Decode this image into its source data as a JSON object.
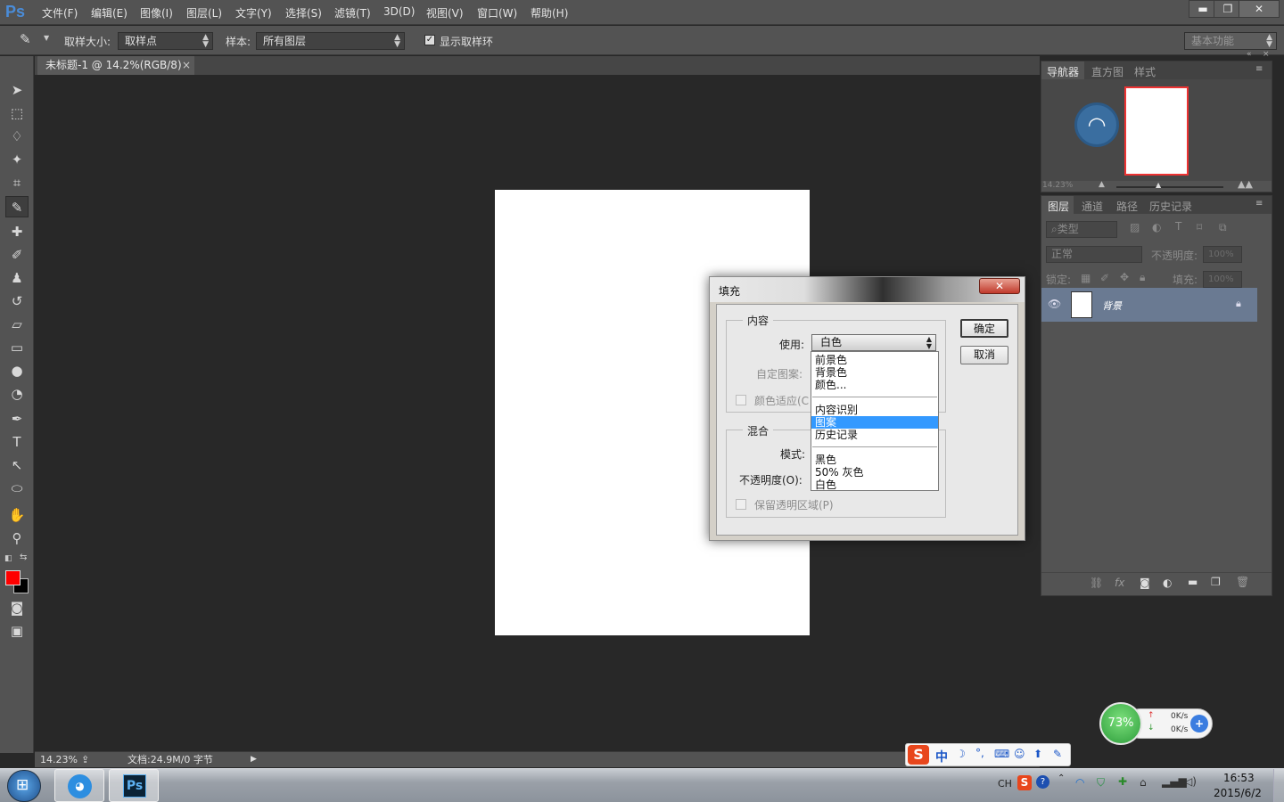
{
  "app": {
    "logo": "Ps"
  },
  "menu": [
    "文件(F)",
    "编辑(E)",
    "图像(I)",
    "图层(L)",
    "文字(Y)",
    "选择(S)",
    "滤镜(T)",
    "3D(D)",
    "视图(V)",
    "窗口(W)",
    "帮助(H)"
  ],
  "window_controls": {
    "minimize": "▬",
    "restore": "❐",
    "close": "✕"
  },
  "options": {
    "sample_size_label": "取样大小:",
    "sample_size_value": "取样点",
    "sample_label": "样本:",
    "sample_value": "所有图层",
    "show_ring_label": "显示取样环",
    "workspace": "基本功能"
  },
  "document": {
    "tab_title": "未标题-1 @ 14.2%(RGB/8)",
    "tab_close": "×"
  },
  "status": {
    "zoom": "14.23%",
    "doc_size": "文档:24.9M/0 字节"
  },
  "navigator": {
    "tabs": [
      "导航器",
      "直方图",
      "样式"
    ],
    "zoom": "14.23%"
  },
  "layers_panel": {
    "tabs": [
      "图层",
      "通道",
      "路径",
      "历史记录"
    ],
    "filter_kind": "类型",
    "blend_mode": "正常",
    "opacity_label": "不透明度:",
    "opacity_value": "100%",
    "lock_label": "锁定:",
    "fill_label": "填充:",
    "fill_value": "100%",
    "layer_name": "背景"
  },
  "dialog": {
    "title": "填充",
    "contents_group": "内容",
    "use_label": "使用:",
    "use_value": "白色",
    "custom_pattern_label": "自定图案:",
    "color_adapt_label": "颜色适应(C",
    "blend_group": "混合",
    "mode_label": "模式:",
    "opacity_label": "不透明度(O):",
    "preserve_label": "保留透明区域(P)",
    "ok": "确定",
    "cancel": "取消",
    "dropdown_items": [
      "前景色",
      "背景色",
      "颜色...",
      "内容识别",
      "图案",
      "历史记录",
      "黑色",
      "50% 灰色",
      "白色"
    ],
    "selected_item": "图案"
  },
  "net_widget": {
    "percent": "73%",
    "up": "0K/s",
    "down": "0K/s"
  },
  "ime_bar": {
    "logo": "S",
    "mode": "中"
  },
  "taskbar": {
    "lang": "CH",
    "time": "16:53",
    "date": "2015/6/2",
    "ps_icon": "Ps"
  },
  "colors": {
    "foreground": "#ff0000",
    "background": "#000000",
    "accent": "#3399ff"
  }
}
